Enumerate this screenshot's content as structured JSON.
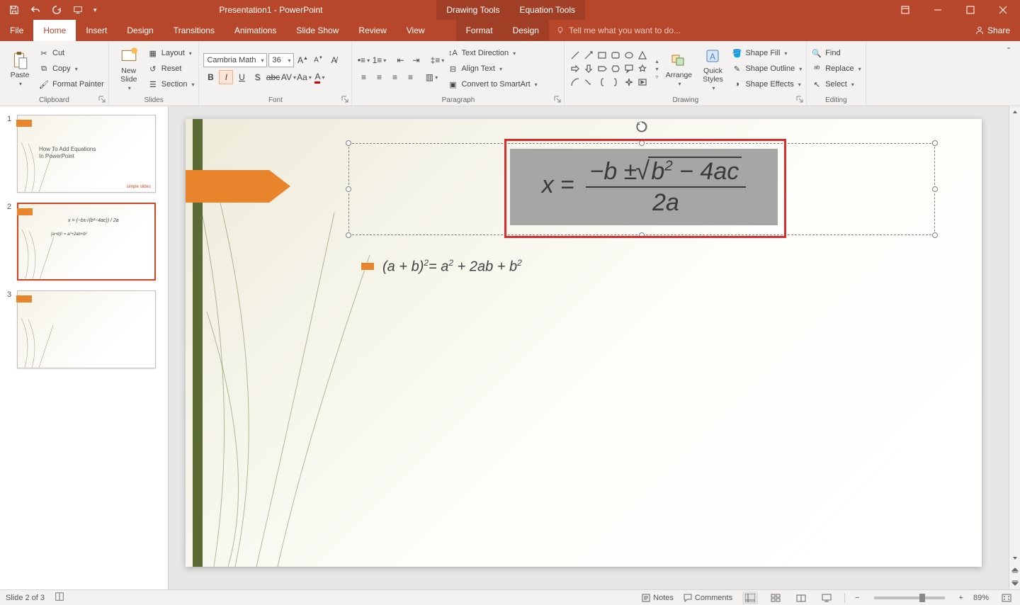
{
  "app_title": "Presentation1 - PowerPoint",
  "context_tabs": {
    "drawing": "Drawing Tools",
    "equation": "Equation Tools",
    "format": "Format",
    "design": "Design"
  },
  "tabs": {
    "file": "File",
    "home": "Home",
    "insert": "Insert",
    "design": "Design",
    "transitions": "Transitions",
    "animations": "Animations",
    "slideshow": "Slide Show",
    "review": "Review",
    "view": "View"
  },
  "tell_me": "Tell me what you want to do...",
  "share": "Share",
  "clipboard": {
    "label": "Clipboard",
    "paste": "Paste",
    "cut": "Cut",
    "copy": "Copy",
    "format_painter": "Format Painter"
  },
  "slides_group": {
    "label": "Slides",
    "new_slide": "New\nSlide",
    "layout": "Layout",
    "reset": "Reset",
    "section": "Section"
  },
  "font_group": {
    "label": "Font",
    "name": "Cambria Math",
    "size": "36"
  },
  "paragraph_group": {
    "label": "Paragraph",
    "text_dir": "Text Direction",
    "align_text": "Align Text",
    "convert": "Convert to SmartArt"
  },
  "drawing_group": {
    "label": "Drawing",
    "arrange": "Arrange",
    "quick_styles": "Quick\nStyles",
    "shape_fill": "Shape Fill",
    "shape_outline": "Shape Outline",
    "shape_effects": "Shape Effects"
  },
  "editing_group": {
    "label": "Editing",
    "find": "Find",
    "replace": "Replace",
    "select": "Select"
  },
  "thumbs": {
    "t1": {
      "num": "1",
      "title": "How To Add Equations\nIn PowerPoint",
      "logo": "simple slides"
    },
    "t2": {
      "num": "2",
      "eq_top": "x = (−b±√(b²−4ac)) / 2a",
      "eq_bot": "(a+b)² = a²+2ab+b²"
    },
    "t3": {
      "num": "3"
    }
  },
  "slide_content": {
    "eq_x": "x",
    "eq_eq": " = ",
    "eq_minus_b": "−b ± ",
    "eq_b2": "b",
    "eq_minus4ac": " − 4ac",
    "eq_2a": "2a",
    "bullet": "(a + b)² = a² + 2ab + b²"
  },
  "statusbar": {
    "slide_info": "Slide 2 of 3",
    "notes": "Notes",
    "comments": "Comments",
    "zoom": "89%"
  }
}
